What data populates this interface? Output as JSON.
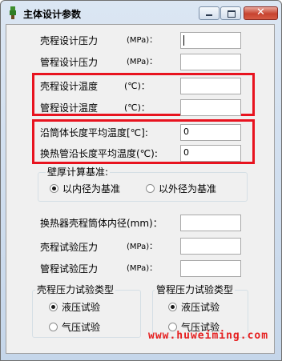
{
  "window": {
    "title": "主体设计参数",
    "close_glyph": "✕",
    "buttons": [
      "minimize",
      "maximize",
      "close"
    ]
  },
  "fields": [
    {
      "label": "壳程设计压力",
      "unit": "(MPa)：",
      "value": ""
    },
    {
      "label": "管程设计压力",
      "unit": "(MPa)：",
      "value": ""
    },
    {
      "label": "壳程设计温度",
      "unit": "(℃)：",
      "value": ""
    },
    {
      "label": "管程设计温度",
      "unit": "(℃)：",
      "value": ""
    },
    {
      "label": "沿筒体长度平均温度[℃]:",
      "unit": "",
      "value": "0"
    },
    {
      "label": "换热管沿长度平均温度(℃):",
      "unit": "",
      "value": "0"
    },
    {
      "label": "换热器壳程筒体内径(mm)：",
      "unit": "",
      "value": ""
    },
    {
      "label": "壳程试验压力",
      "unit": "(MPa)：",
      "value": ""
    },
    {
      "label": "管程试验压力",
      "unit": "(MPa)：",
      "value": ""
    }
  ],
  "wall_thickness_group": {
    "title": "壁厚计算基准:",
    "options": [
      "以内径为基准",
      "以外径为基准"
    ],
    "selected": 0
  },
  "shell_test_group": {
    "title": "壳程压力试验类型",
    "options": [
      "液压试验",
      "气压试验"
    ],
    "selected": 0
  },
  "tube_test_group": {
    "title": "管程压力试验类型",
    "options": [
      "液压试验",
      "气压试验"
    ],
    "selected": 0
  },
  "watermark": "www.huweiming.com",
  "highlight_color": "#e8131f"
}
